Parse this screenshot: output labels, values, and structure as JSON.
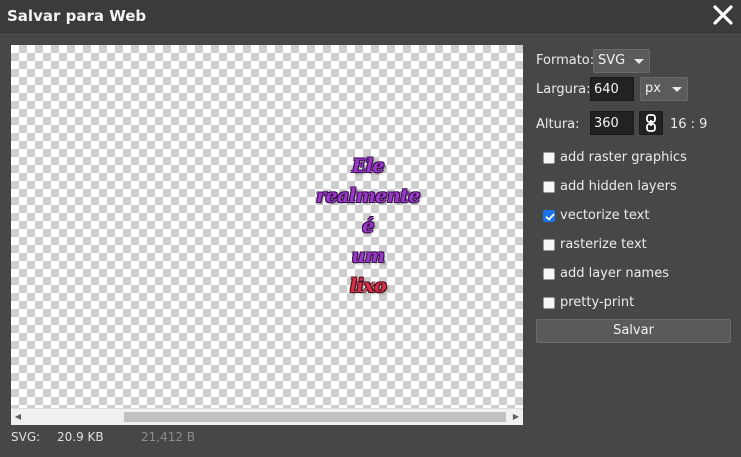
{
  "window": {
    "title": "Salvar para Web",
    "close_icon": "close-icon"
  },
  "preview": {
    "artwork_lines": [
      "Ele",
      "realmente",
      "é",
      "um",
      "lixo"
    ],
    "artwork_colors": {
      "primary": "#9b39c9",
      "accent": "#d8324a"
    },
    "background": "transparency-checkerboard"
  },
  "footer": {
    "format_label": "SVG:",
    "file_size": "20.9 KB",
    "byte_count": "21,412 B"
  },
  "options": {
    "format_label": "Formato:",
    "format_value": "SVG",
    "width_label": "Largura:",
    "width_value": "640",
    "unit_value": "px",
    "height_label": "Altura:",
    "height_value": "360",
    "link_icon": "chain-link-icon",
    "aspect_ratio": "16 : 9",
    "checkboxes": [
      {
        "label": "add raster graphics",
        "checked": false
      },
      {
        "label": "add hidden layers",
        "checked": false
      },
      {
        "label": "vectorize text",
        "checked": true
      },
      {
        "label": "rasterize text",
        "checked": false
      },
      {
        "label": "add layer names",
        "checked": false
      },
      {
        "label": "pretty-print",
        "checked": false
      }
    ],
    "save_label": "Salvar"
  },
  "colors": {
    "dialog_bg": "#474747",
    "titlebar_bg": "#3b3b3b",
    "checkbox_checked": "#1a73e8"
  }
}
